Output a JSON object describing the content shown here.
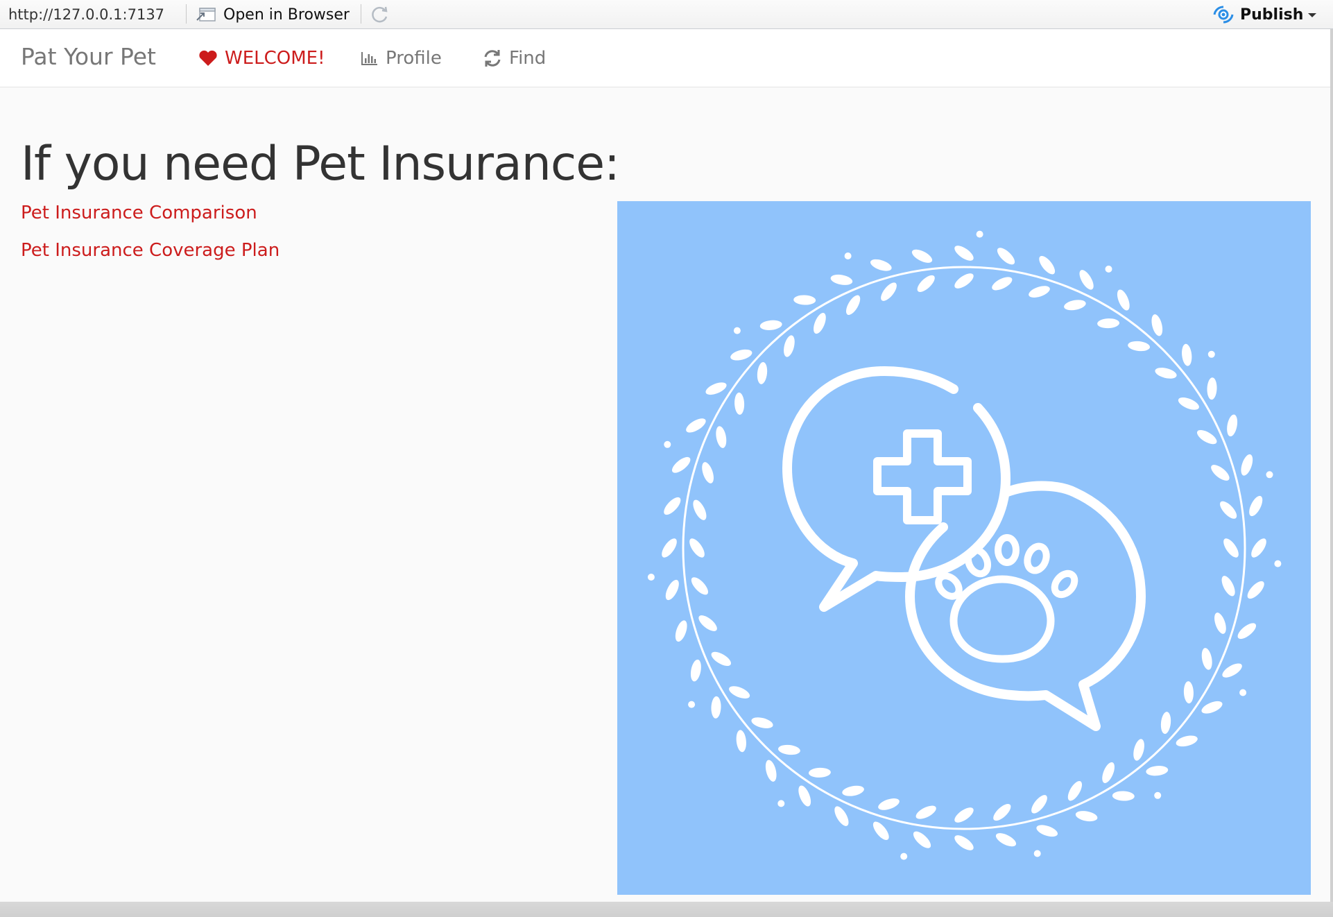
{
  "viewer": {
    "url": "http://127.0.0.1:7137",
    "open_in_browser": "Open in Browser",
    "publish": "Publish",
    "icons": {
      "open": "open-external-icon",
      "refresh": "refresh-icon",
      "publish": "publish-icon",
      "menu": "caret-down-icon"
    }
  },
  "navbar": {
    "brand": "Pat Your Pet",
    "items": [
      {
        "label": "WELCOME!",
        "icon": "heart-icon",
        "active": true
      },
      {
        "label": "Profile",
        "icon": "bar-chart-icon",
        "active": false
      },
      {
        "label": "Find",
        "icon": "refresh-icon",
        "active": false
      }
    ]
  },
  "main": {
    "heading": "If you need Pet Insurance:",
    "links": [
      "Pet Insurance Comparison",
      "Pet Insurance Coverage Plan"
    ],
    "hero": {
      "icon": "pet-health-chat-icon",
      "background": "#90c3fb"
    }
  },
  "colors": {
    "accent": "#cc1c1c",
    "muted": "#777777",
    "heading": "#333333"
  }
}
